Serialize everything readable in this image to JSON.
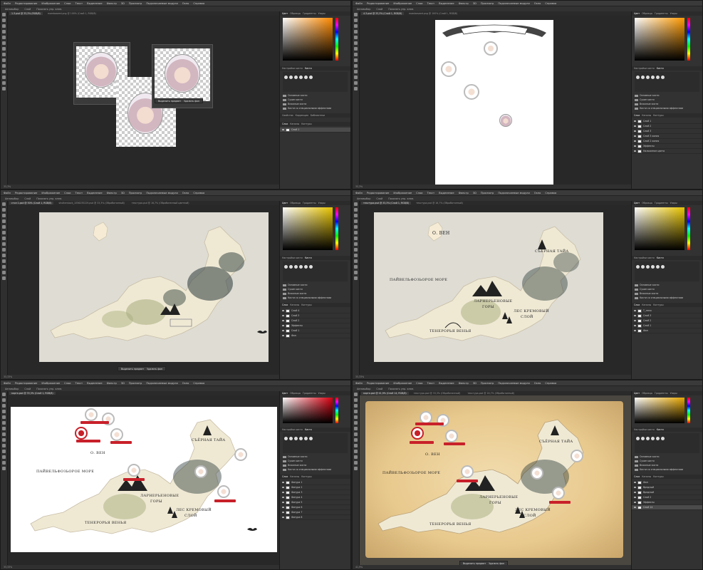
{
  "menu": [
    "Файл",
    "Редактирование",
    "Изображение",
    "Слои",
    "Текст",
    "Выделение",
    "Фильтр",
    "3D",
    "Просмотр",
    "Подключаемые модули",
    "Окно",
    "Справка"
  ],
  "options": [
    "Автовыбор",
    "Слой",
    "Показать упр. элем."
  ],
  "panels": {
    "color_tab": "Цвет",
    "swatches_tab": "Образцы",
    "gradients_tab": "Градиенты",
    "patterns_tab": "Узоры",
    "brush_settings_tab": "Настройки кисти",
    "brushes_tab": "Кисти",
    "layers_tab": "Слои",
    "channels_tab": "Каналы",
    "contours_tab": "Контуры",
    "properties_tab": "Свойства",
    "corrections_tab": "Коррекция",
    "libraries_tab": "Библиотеки",
    "brush_folders": [
      "Основные кисти",
      "Сухие кисти",
      "Влажные кисти",
      "Кисти со специальными эффектами"
    ]
  },
  "floating_bar": {
    "select_subject": "Выделить предмет",
    "remove_bg": "Удалить фон"
  },
  "shots": [
    {
      "tabs": [
        "1-3.psd @ 33,3% (RGB/8)",
        "mambaseed.png @ 100% (Слой 1, RGB/8)"
      ],
      "status": "33,3%",
      "layers": [
        {
          "name": "Слой 1",
          "sel": true
        }
      ]
    },
    {
      "tabs": [
        "4-3.psd @ 33,3% (Слой 1, RGB/8)",
        "mambaseed.png @ 100% (Слой 1, RGB/8)"
      ],
      "status": "33,3%",
      "layers": [
        {
          "name": "Слой 1",
          "sel": false
        },
        {
          "name": "Слой 2",
          "sel": false
        },
        {
          "name": "Слой 3",
          "sel": false
        },
        {
          "name": "Слой 3 копия",
          "sel": false
        },
        {
          "name": "Слой 2 копия",
          "sel": false
        },
        {
          "name": "Эффекты",
          "sel": false
        },
        {
          "name": "Наложение цвета",
          "sel": false
        }
      ]
    },
    {
      "tabs": [
        "стол 1.psd @ 50% (Слой 1, RGB/8)",
        "shutterstock_1056235229.psd @ 33,3% (Обработанный)",
        "текстура.psd @ 16,7% (Обработанный цветной)"
      ],
      "status": "33,33%",
      "layers": [
        {
          "name": "Слой 4",
          "sel": false
        },
        {
          "name": "Слой 3",
          "sel": false
        },
        {
          "name": "Слой 2",
          "sel": false
        },
        {
          "name": "Эффекты",
          "sel": false
        },
        {
          "name": "Слой 1",
          "sel": false
        },
        {
          "name": "Фон",
          "sel": false
        }
      ]
    },
    {
      "tabs": [
        "текстура.psd @ 33,3% (Слой 1, RGB/8)",
        "текстура.psd @ 16,7% (Обработанный)"
      ],
      "status": "33,33%",
      "layers": [
        {
          "name": "Т_тени",
          "sel": false
        },
        {
          "name": "Слой 3",
          "sel": false
        },
        {
          "name": "Слой 2",
          "sel": false
        },
        {
          "name": "Слой 1",
          "sel": false
        },
        {
          "name": "Фон",
          "sel": false
        }
      ]
    },
    {
      "tabs": [
        "карта.psd @ 33,3% (Слой 1, RGB/8)"
      ],
      "status": "33,33%",
      "layers": [
        {
          "name": "Фигура 1",
          "sel": false
        },
        {
          "name": "Фигура 2",
          "sel": false
        },
        {
          "name": "Фигура 3",
          "sel": false
        },
        {
          "name": "Фигура 4",
          "sel": false
        },
        {
          "name": "Фигура 5",
          "sel": false
        },
        {
          "name": "Фигура 6",
          "sel": false
        },
        {
          "name": "Фигура 7",
          "sel": false
        },
        {
          "name": "Фигура 8",
          "sel": false
        }
      ]
    },
    {
      "tabs": [
        "карта.psd @ 41,9% (Слой 14, RGB/8)",
        "текстура.psd @ 33,3% (Обработанный)",
        "текстура.psd @ 16,7% (Обработанный)"
      ],
      "status": "41,9%",
      "layers": [
        {
          "name": "Фон",
          "sel": false
        },
        {
          "name": "Вредный",
          "sel": false
        },
        {
          "name": "Вредный",
          "sel": false
        },
        {
          "name": "Слой 2",
          "sel": false
        },
        {
          "name": "Эффекты",
          "sel": false
        },
        {
          "name": "Слой 14",
          "sel": true
        }
      ]
    }
  ],
  "map_labels": {
    "sea": "ПАЙВЕЛЬФОЗЬОРОЕ МОРЕ",
    "north": "СЪЁРНАЯ ТАЙА",
    "mountains_1": "ЛАРНЕРЬЕНОВЫЕ",
    "mountains_2": "ГОРЫ",
    "forest_1": "ЛЕС КРЕМОВЫЙ",
    "forest_2": "СЛОЙ",
    "desert": "ТЕНЕРОРЬЯ ВЕНЬЯ",
    "island": "О. ВЕН"
  }
}
